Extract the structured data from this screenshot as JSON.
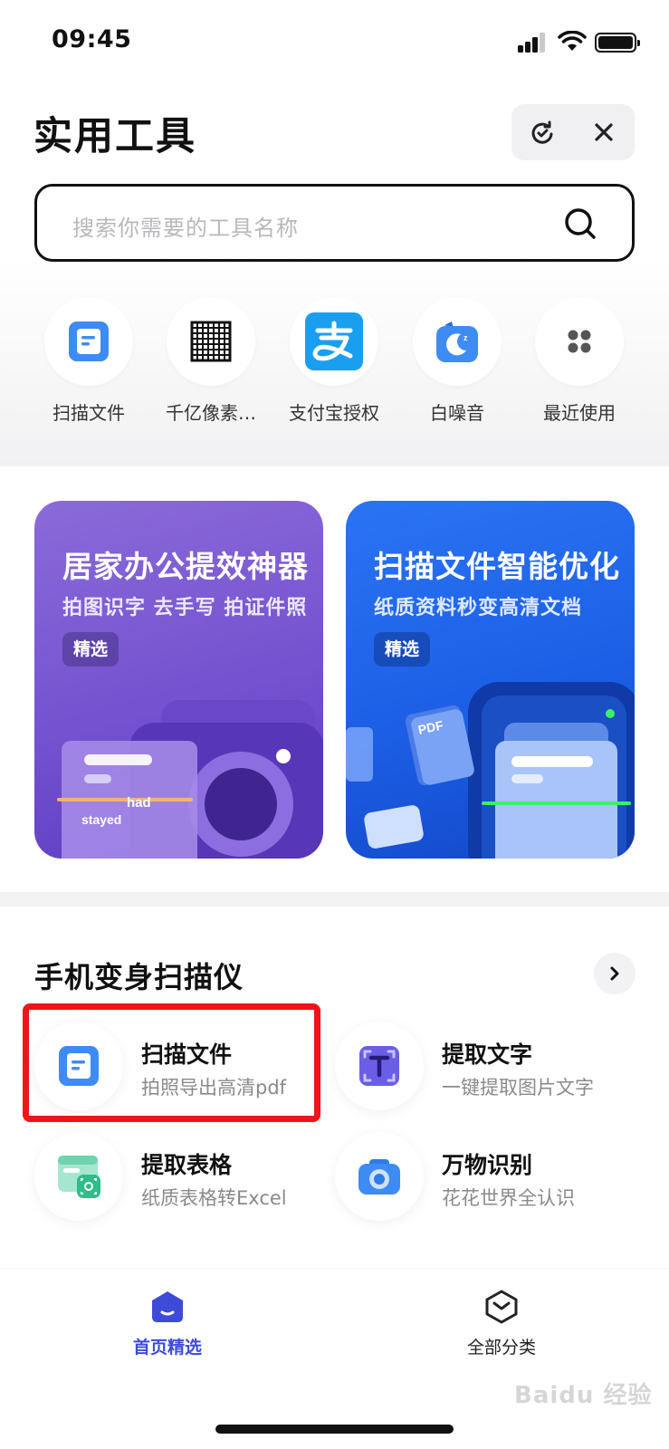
{
  "status_bar": {
    "time": "09:45"
  },
  "header": {
    "title": "实用工具"
  },
  "search": {
    "placeholder": "搜索你需要的工具名称"
  },
  "quick_tools": [
    {
      "label": "扫描文件",
      "icon": "scan-doc-icon"
    },
    {
      "label": "千亿像素…",
      "icon": "grid-pixel-icon"
    },
    {
      "label": "支付宝授权",
      "icon": "alipay-icon"
    },
    {
      "label": "白噪音",
      "icon": "moon-sound-icon"
    },
    {
      "label": "最近使用",
      "icon": "four-dots-icon"
    }
  ],
  "banners": [
    {
      "title": "居家办公提效神器",
      "subtitle": "拍图识字 去手写 拍证件照",
      "tag": "精选",
      "illustration_text": [
        "had",
        "stayed"
      ]
    },
    {
      "title": "扫描文件智能优化",
      "subtitle": "纸质资料秒变高清文档",
      "tag": "精选",
      "illustration_text": [
        "PDF"
      ]
    }
  ],
  "section": {
    "title": "手机变身扫描仪",
    "tools": [
      {
        "name": "扫描文件",
        "desc": "拍照导出高清pdf",
        "icon": "scan-doc-icon"
      },
      {
        "name": "提取文字",
        "desc": "一键提取图片文字",
        "icon": "text-extract-icon"
      },
      {
        "name": "提取表格",
        "desc": "纸质表格转Excel",
        "icon": "table-extract-icon"
      },
      {
        "name": "万物识别",
        "desc": "花花世界全认识",
        "icon": "camera-icon"
      }
    ]
  },
  "tabbar": {
    "tabs": [
      {
        "label": "首页精选",
        "active": true
      },
      {
        "label": "全部分类",
        "active": false
      }
    ]
  },
  "watermark": "Baidu 经验",
  "colors": {
    "accent": "#3d4bd8",
    "highlight_border": "#f0141a",
    "alipay": "#1a9ff0"
  }
}
